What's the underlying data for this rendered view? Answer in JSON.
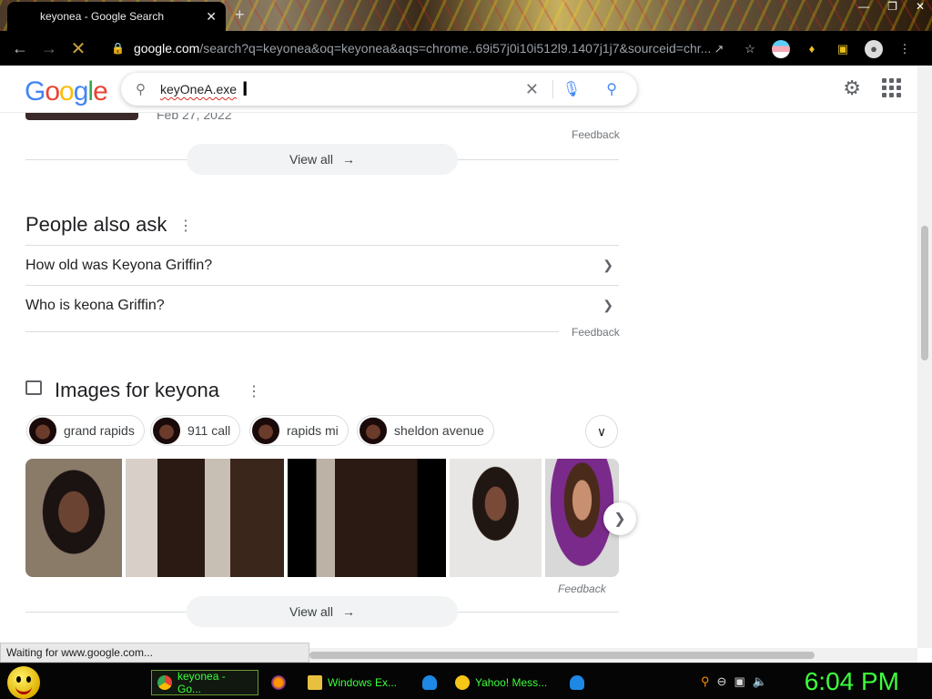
{
  "browser": {
    "tab_title": "keyonea - Google Search",
    "tab_close": "✕",
    "new_tab": "+",
    "url_host": "google.com",
    "url_rest": "/search?q=keyonea&oq=keyonea&aqs=chrome..69i57j0i10i512l9.1407j1j7&sourceid=chr...",
    "status_text": "Waiting for www.google.com..."
  },
  "google": {
    "logo_letters": [
      "G",
      "o",
      "o",
      "g",
      "l",
      "e"
    ],
    "logo_colors": [
      "#4285f4",
      "#ea4335",
      "#fbbc05",
      "#4285f4",
      "#34a853",
      "#ea4335"
    ],
    "query": "keyOneA.exe",
    "date_partial": "Feb 27, 2022"
  },
  "sections": {
    "feedback1": "Feedback",
    "view_all_1": "View all",
    "paa_title": "People also ask",
    "paa_items": [
      "How old was Keyona Griffin?",
      "Who is keona Griffin?"
    ],
    "feedback2": "Feedback",
    "images_title": "Images for keyona",
    "chips": [
      "grand rapids",
      "911 call",
      "rapids mi",
      "sheldon avenue"
    ],
    "feedback3": "Feedback",
    "view_all_2": "View all"
  },
  "taskbar": {
    "tasks": [
      "keyonea - Go...",
      "Windows Ex...",
      "Yahoo! Mess..."
    ],
    "clock": "6:04 PM"
  }
}
